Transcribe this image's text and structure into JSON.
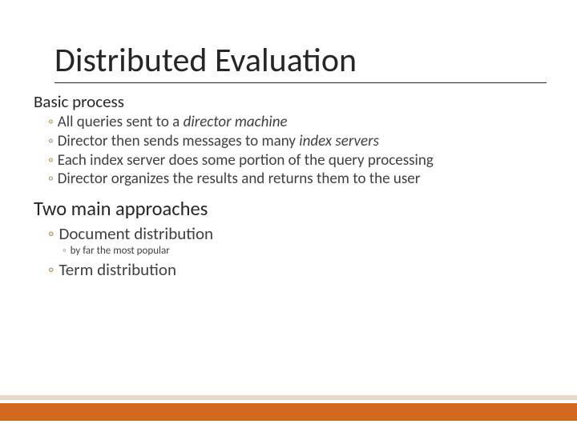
{
  "title": "Distributed Evaluation",
  "section1": {
    "heading": "Basic process",
    "b1_pre": "All queries sent to a ",
    "b1_em": "director machine",
    "b2_pre": "Director then sends messages to many ",
    "b2_em": "index servers",
    "b3": "Each index server does some portion of the query processing",
    "b4": "Director organizes the results and returns them to the user"
  },
  "section2": {
    "heading": "Two main approaches",
    "b1": "Document distribution",
    "b1_sub": "by far the most popular",
    "b2": "Term distribution"
  },
  "bullet": "◦"
}
